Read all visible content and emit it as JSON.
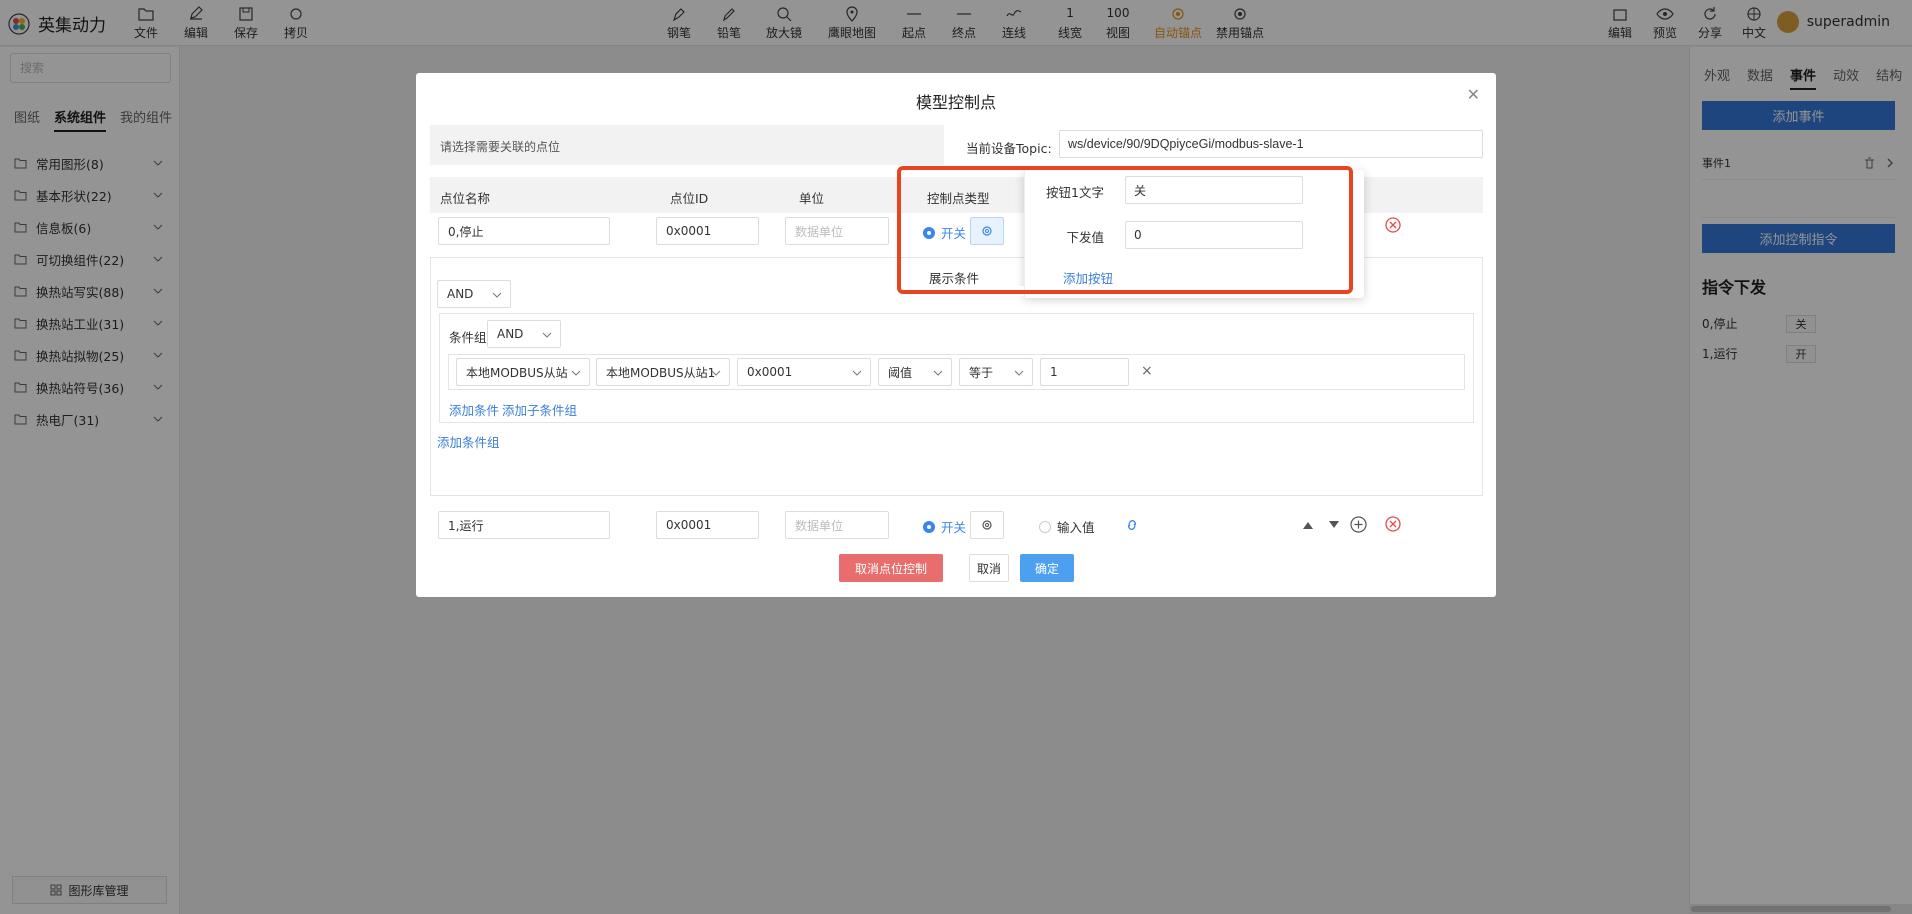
{
  "app": {
    "title": "英集动力"
  },
  "toolbar_left": [
    {
      "label": "文件",
      "icon": "folder-icon"
    },
    {
      "label": "编辑",
      "icon": "edit-icon"
    },
    {
      "label": "保存",
      "icon": "save-icon"
    },
    {
      "label": "拷贝",
      "icon": "copy-icon"
    }
  ],
  "toolbar_center": [
    {
      "label": "钢笔",
      "icon": "pen-icon"
    },
    {
      "label": "铅笔",
      "icon": "pencil-icon"
    },
    {
      "label": "放大镜",
      "icon": "magnifier-icon"
    },
    {
      "label": "鹰眼地图",
      "icon": "map-pin-icon"
    },
    {
      "label": "起点",
      "icon": "line-start-icon"
    },
    {
      "label": "终点",
      "icon": "line-end-icon"
    },
    {
      "label": "连线",
      "icon": "curve-icon"
    },
    {
      "label": "线宽",
      "value": "1"
    },
    {
      "label": "视图",
      "value": "100"
    },
    {
      "label": "自动锚点",
      "icon": "anchor-icon",
      "color": "#e8941a"
    },
    {
      "label": "禁用锚点",
      "icon": "disable-anchor-icon"
    }
  ],
  "toolbar_right": [
    {
      "label": "编辑",
      "icon": "edit-doc-icon"
    },
    {
      "label": "预览",
      "icon": "eye-icon"
    },
    {
      "label": "分享",
      "icon": "share-icon"
    },
    {
      "label": "中文",
      "icon": "globe-icon"
    }
  ],
  "user": {
    "name": "superadmin"
  },
  "left_panel": {
    "search_placeholder": "搜索",
    "tabs": [
      "图纸",
      "系统组件",
      "我的组件"
    ],
    "active_tab": "系统组件",
    "categories": [
      "常用图形(8)",
      "基本形状(22)",
      "信息板(6)",
      "可切换组件(22)",
      "换热站写实(88)",
      "换热站工业(31)",
      "换热站拟物(25)",
      "换热站符号(36)",
      "热电厂(31)"
    ],
    "library_button": "图形库管理"
  },
  "right_panel": {
    "tabs": [
      "外观",
      "数据",
      "事件",
      "动效",
      "结构"
    ],
    "active_tab": "事件",
    "add_event": "添加事件",
    "event_name": "事件1",
    "add_control_command": "添加控制指令",
    "command_title": "指令下发",
    "commands": [
      {
        "name": "0,停止",
        "value": "关"
      },
      {
        "name": "1,运行",
        "value": "开"
      }
    ]
  },
  "modal": {
    "title": "模型控制点",
    "hint": "请选择需要关联的点位",
    "topic_label": "当前设备Topic:",
    "topic_value": "ws/device/90/9DQpiyceGi/modbus-slave-1",
    "columns": [
      "点位名称",
      "点位ID",
      "单位",
      "控制点类型"
    ],
    "rows": [
      {
        "name": "0,停止",
        "id": "0x0001",
        "unit_placeholder": "数据单位",
        "switch_label": "开关"
      },
      {
        "name": "1,运行",
        "id": "0x0001",
        "unit_placeholder": "数据单位",
        "switch_label": "开关",
        "input_label": "输入值"
      }
    ],
    "condition": {
      "logic": "AND",
      "group_label": "条件组",
      "group_logic": "AND",
      "fields": [
        "本地MODBUS从站",
        "本地MODBUS从站1",
        "0x0001",
        "阈值",
        "等于"
      ],
      "value": "1",
      "add_condition": "添加条件",
      "add_sub_group": "添加子条件组",
      "add_group": "添加条件组"
    },
    "display_condition": "展示条件",
    "cancel_control": "取消点位控制",
    "cancel": "取消",
    "confirm": "确定"
  },
  "popover": {
    "button_text_label": "按钮1文字",
    "button_text_value": "关",
    "send_value_label": "下发值",
    "send_value": "0",
    "add_button": "添加按钮"
  }
}
